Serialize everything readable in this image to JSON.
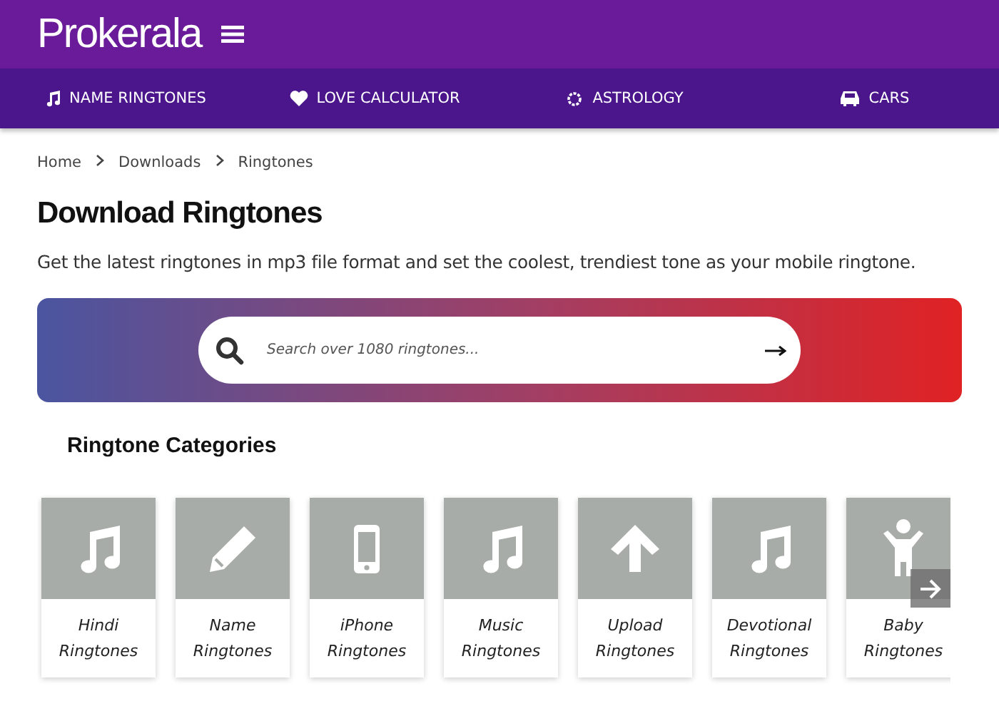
{
  "header": {
    "logo": "Prokerala"
  },
  "nav": [
    {
      "label": "NAME RINGTONES",
      "kind": "music"
    },
    {
      "label": "LOVE CALCULATOR",
      "kind": "heart"
    },
    {
      "label": "ASTROLOGY",
      "kind": "sun"
    },
    {
      "label": "CARS",
      "kind": "car"
    }
  ],
  "breadcrumb": [
    "Home",
    "Downloads",
    "Ringtones"
  ],
  "title": "Download Ringtones",
  "description": "Get the latest ringtones in mp3 file format and set the coolest, trendiest tone as your mobile ringtone.",
  "search": {
    "placeholder": "Search over 1080 ringtones..."
  },
  "categories": {
    "heading": "Ringtone Categories",
    "items": [
      {
        "line1": "Hindi",
        "line2": "Ringtones",
        "kind": "music"
      },
      {
        "line1": "Name",
        "line2": "Ringtones",
        "kind": "pencil"
      },
      {
        "line1": "iPhone",
        "line2": "Ringtones",
        "kind": "phone"
      },
      {
        "line1": "Music",
        "line2": "Ringtones",
        "kind": "music"
      },
      {
        "line1": "Upload",
        "line2": "Ringtones",
        "kind": "upload"
      },
      {
        "line1": "Devotional",
        "line2": "Ringtones",
        "kind": "music"
      },
      {
        "line1": "Baby",
        "line2": "Ringtones",
        "kind": "child"
      }
    ]
  }
}
